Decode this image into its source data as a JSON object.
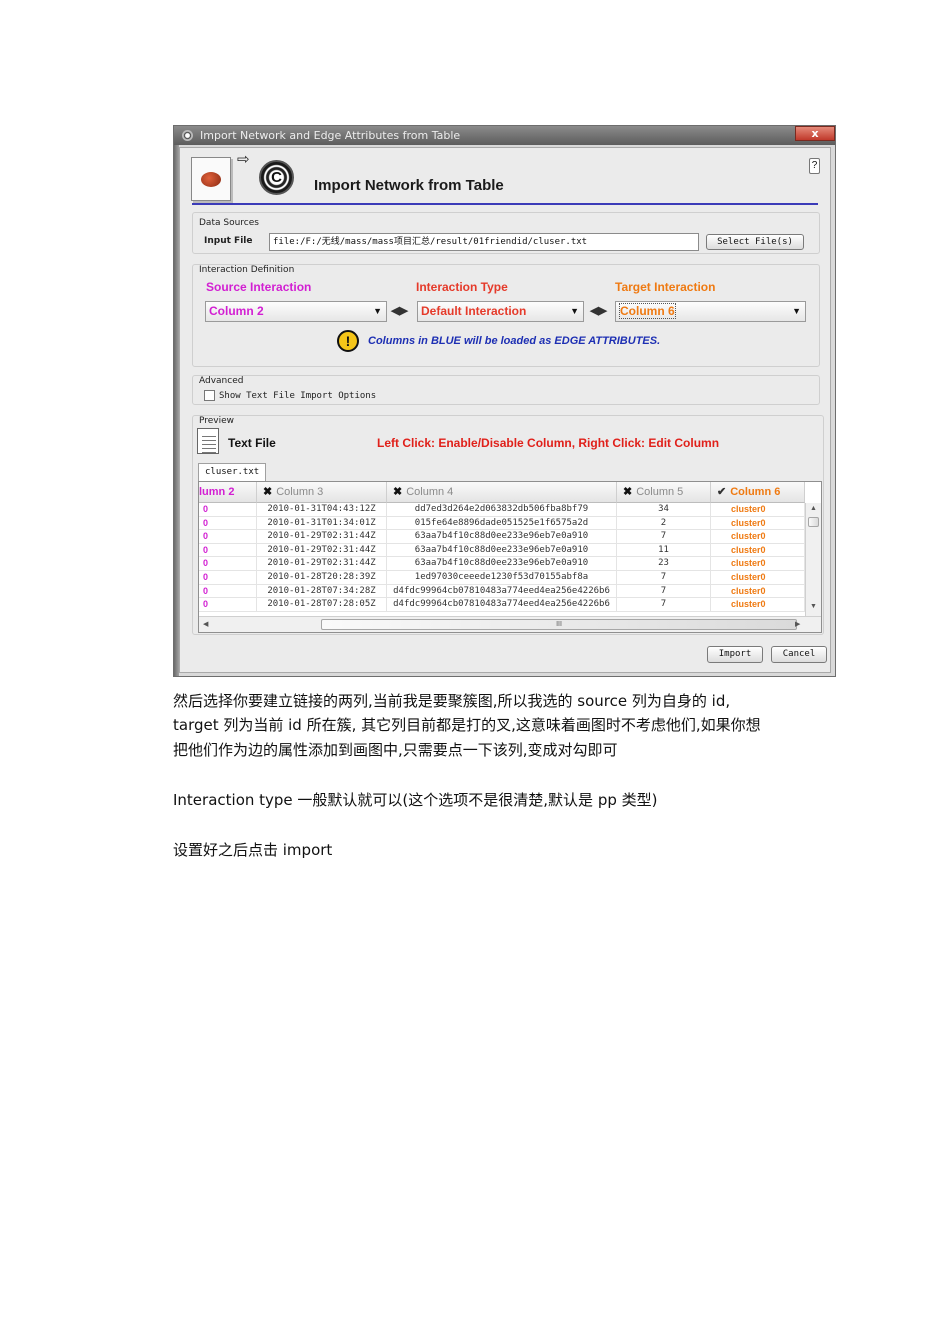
{
  "window": {
    "title": "Import Network and Edge Attributes from Table",
    "close_label": "x",
    "header_title": "Import Network from Table",
    "help_label": "?"
  },
  "data_sources": {
    "section_label": "Data Sources",
    "input_file_label": "Input File",
    "input_file_value": "file:/F:/无线/mass/mass项目汇总/result/01friendid/cluser.txt",
    "select_files_label": "Select File(s)"
  },
  "interaction": {
    "section_label": "Interaction Definition",
    "source_label": "Source Interaction",
    "type_label": "Interaction Type",
    "target_label": "Target Interaction",
    "source_value": "Column 2",
    "type_value": "Default Interaction",
    "target_value": "Column 6",
    "warning_text": "Columns in BLUE will be loaded as EDGE ATTRIBUTES.",
    "colors": {
      "source": "#d21fd2",
      "type": "#e53a2a",
      "target": "#ef7a12",
      "warning": "#1d2fb3"
    }
  },
  "advanced": {
    "section_label": "Advanced",
    "show_options_label": "Show Text File Import Options",
    "show_options_checked": false
  },
  "preview": {
    "section_label": "Preview",
    "text_file_label": "Text File",
    "hint": "Left Click: Enable/Disable Column, Right Click: Edit Column",
    "tab_label": "cluser.txt",
    "columns": [
      {
        "label": "lumn 2",
        "state": "source"
      },
      {
        "label": "Column 3",
        "state": "disabled"
      },
      {
        "label": "Column 4",
        "state": "disabled"
      },
      {
        "label": "Column 5",
        "state": "disabled"
      },
      {
        "label": "Column 6",
        "state": "target"
      }
    ],
    "rows": [
      [
        "0",
        "2010-01-31T04:43:12Z",
        "dd7ed3d264e2d063832db506fba8bf79",
        "34",
        "cluster0"
      ],
      [
        "0",
        "2010-01-31T01:34:01Z",
        "015fe64e8896dade051525e1f6575a2d",
        "2",
        "cluster0"
      ],
      [
        "0",
        "2010-01-29T02:31:44Z",
        "63aa7b4f10c88d0ee233e96eb7e0a910",
        "7",
        "cluster0"
      ],
      [
        "0",
        "2010-01-29T02:31:44Z",
        "63aa7b4f10c88d0ee233e96eb7e0a910",
        "11",
        "cluster0"
      ],
      [
        "0",
        "2010-01-29T02:31:44Z",
        "63aa7b4f10c88d0ee233e96eb7e0a910",
        "23",
        "cluster0"
      ],
      [
        "0",
        "2010-01-28T20:28:39Z",
        "1ed97030ceeede1230f53d70155abf8a",
        "7",
        "cluster0"
      ],
      [
        "0",
        "2010-01-28T07:34:28Z",
        "d4fdc99964cb07810483a774eed4ea256e4226b6",
        "7",
        "cluster0"
      ],
      [
        "0",
        "2010-01-28T07:28:05Z",
        "d4fdc99964cb07810483a774eed4ea256e4226b6",
        "7",
        "cluster0"
      ]
    ],
    "hscroll_mid": "III"
  },
  "footer": {
    "import_label": "Import",
    "cancel_label": "Cancel"
  },
  "doc": {
    "para1_line1": "然后选择你要建立链接的两列,当前我是要聚簇图,所以我选的 source 列为自身的 id,",
    "para1_line2": "target 列为当前 id 所在簇,  其它列目前都是打的叉,这意味着画图时不考虑他们,如果你想",
    "para1_line3": "把他们作为边的属性添加到画图中,只需要点一下该列,变成对勾即可",
    "para2": "Interaction type 一般默认就可以(这个选项不是很清楚,默认是 pp 类型)",
    "para3": "设置好之后点击 import"
  }
}
